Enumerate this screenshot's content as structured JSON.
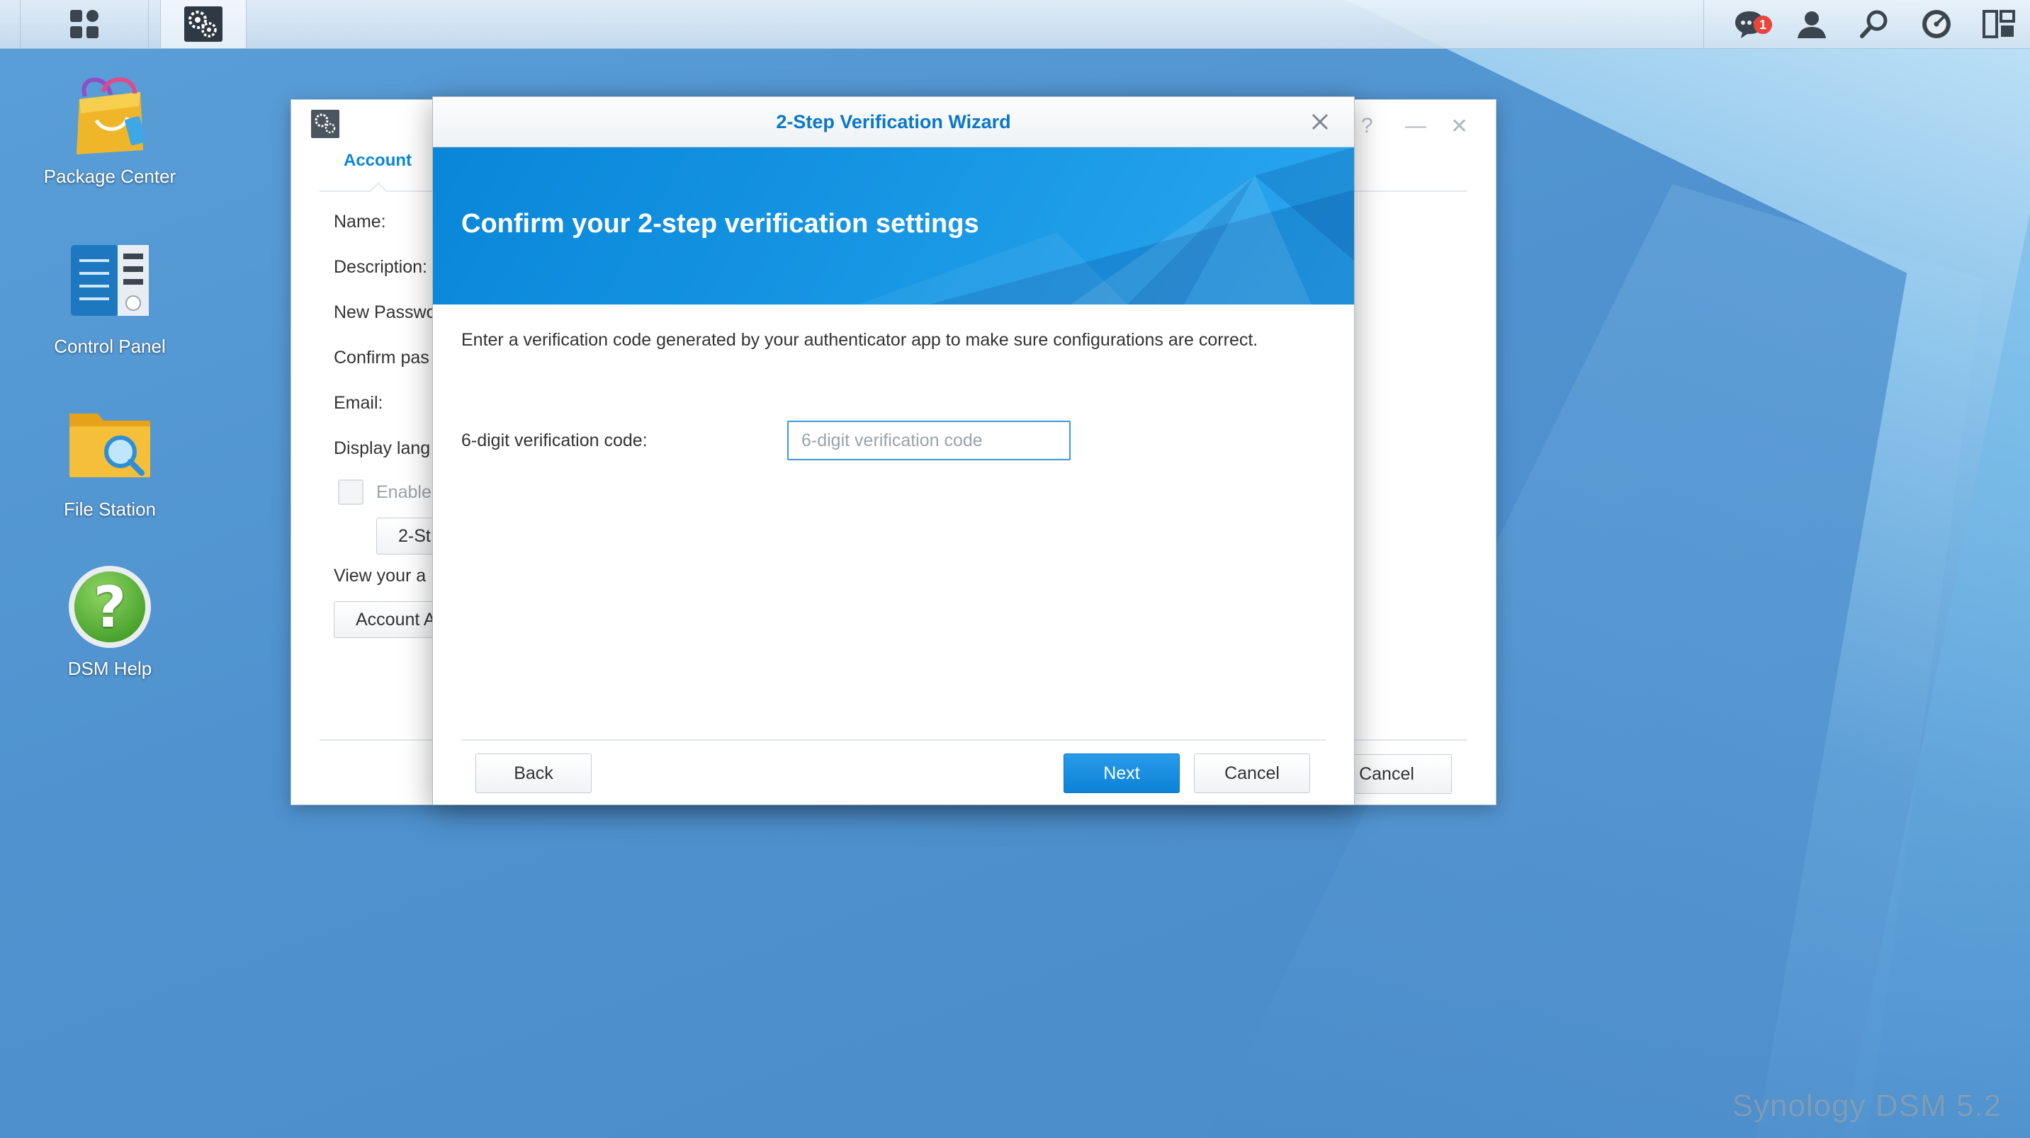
{
  "desktop": {
    "icons": [
      {
        "label": "Package Center"
      },
      {
        "label": "Control Panel"
      },
      {
        "label": "File Station"
      },
      {
        "label": "DSM Help"
      }
    ],
    "brand": "Synology DSM 5.2"
  },
  "taskbar": {
    "notification_count": "1"
  },
  "control_panel": {
    "tab": "Account",
    "labels": {
      "name": "Name:",
      "description": "Description:",
      "new_password": "New Passwo",
      "confirm_password": "Confirm pas",
      "email": "Email:",
      "display_language": "Display lang",
      "enable": "Enable",
      "view_your": "View your a"
    },
    "two_step_button": "2-St",
    "account_button": "Account A",
    "cancel_button": "Cancel"
  },
  "wizard": {
    "title": "2-Step Verification Wizard",
    "heading": "Confirm your 2-step verification settings",
    "description": "Enter a verification code generated by your authenticator app to make sure configurations are correct.",
    "code_label": "6-digit verification code:",
    "code_value": "",
    "code_placeholder": "6-digit verification code",
    "back_button": "Back",
    "next_button": "Next",
    "cancel_button": "Cancel"
  },
  "colors": {
    "accent": "#0a86d8",
    "title_text": "#0a78c8",
    "badge": "#e8453c"
  }
}
